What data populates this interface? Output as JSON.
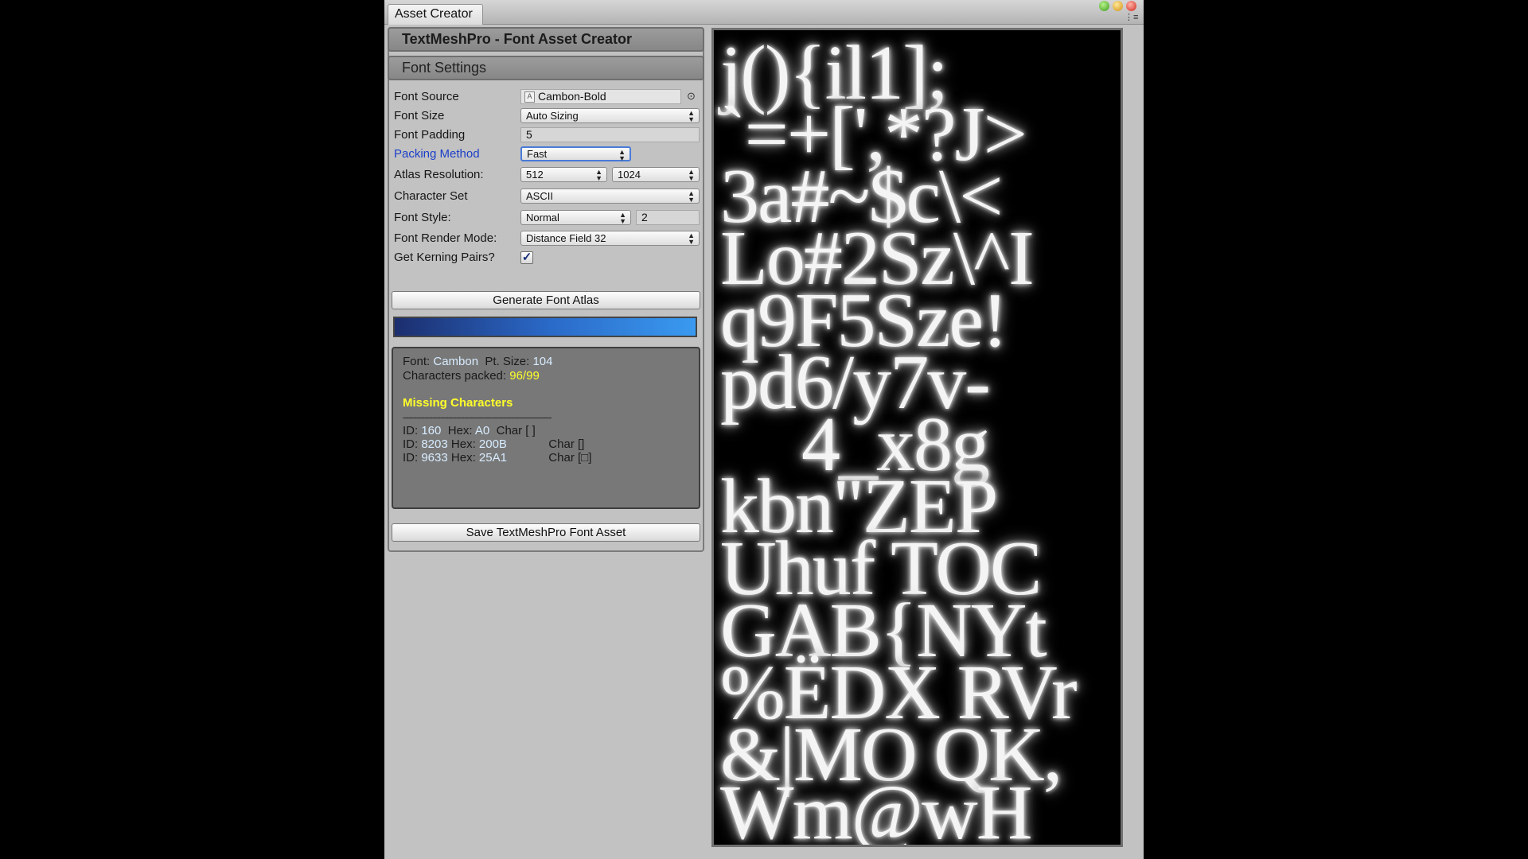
{
  "window": {
    "tab_title": "Asset Creator",
    "menu_glyph": "⋮≡"
  },
  "header": {
    "title": "TextMeshPro - Font Asset Creator"
  },
  "section": {
    "title": "Font Settings"
  },
  "settings": {
    "font_source": {
      "label": "Font Source",
      "value": "Cambon-Bold",
      "icon": "font-file-icon",
      "picker_glyph": "⊙"
    },
    "font_size": {
      "label": "Font Size",
      "value": "Auto Sizing"
    },
    "font_padding": {
      "label": "Font Padding",
      "value": "5"
    },
    "packing_method": {
      "label": "Packing Method",
      "value": "Fast"
    },
    "atlas_resolution": {
      "label": "Atlas Resolution:",
      "width": "512",
      "height": "1024"
    },
    "character_set": {
      "label": "Character Set",
      "value": "ASCII"
    },
    "font_style": {
      "label": "Font Style:",
      "value": "Normal",
      "amount": "2"
    },
    "render_mode": {
      "label": "Font Render Mode:",
      "value": "Distance Field 32"
    },
    "kerning": {
      "label": "Get Kerning Pairs?",
      "checked": true,
      "check_glyph": "✓"
    }
  },
  "actions": {
    "generate_label": "Generate Font Atlas",
    "save_label": "Save TextMeshPro Font Asset"
  },
  "progress": {
    "fraction": 1.0
  },
  "info": {
    "font_label": "Font:",
    "font_value": "Cambon",
    "ptsize_label": "Pt. Size:",
    "ptsize_value": "104",
    "packed_label": "Characters packed:",
    "packed_value": "96/99",
    "missing_title": "Missing Characters",
    "separator": "--------------------------------------------------------",
    "missing": [
      {
        "id_label": "ID:",
        "id": "160",
        "hex_label": "Hex:",
        "hex": "A0",
        "char_label": "Char [ ]"
      },
      {
        "id_label": "ID:",
        "id": "8203",
        "hex_label": "Hex:",
        "hex": "200B",
        "char_label": "Char []"
      },
      {
        "id_label": "ID:",
        "id": "9633",
        "hex_label": "Hex:",
        "hex": "25A1",
        "char_label": "Char [□]"
      }
    ]
  },
  "atlas": {
    "rows": [
      "j(){il1];",
      "`=+[',*?J>",
      "3a#~$c\\<",
      "Lo#2Sz\\^I",
      "q9F5Sze!",
      "pd6/y7v-",
      "4_x8g",
      "kbn\"ZEP",
      "Uhuf TOC",
      "GAB{NYt",
      "%ËDX RVr",
      "&|MO QK,",
      "Wm@wH"
    ]
  }
}
